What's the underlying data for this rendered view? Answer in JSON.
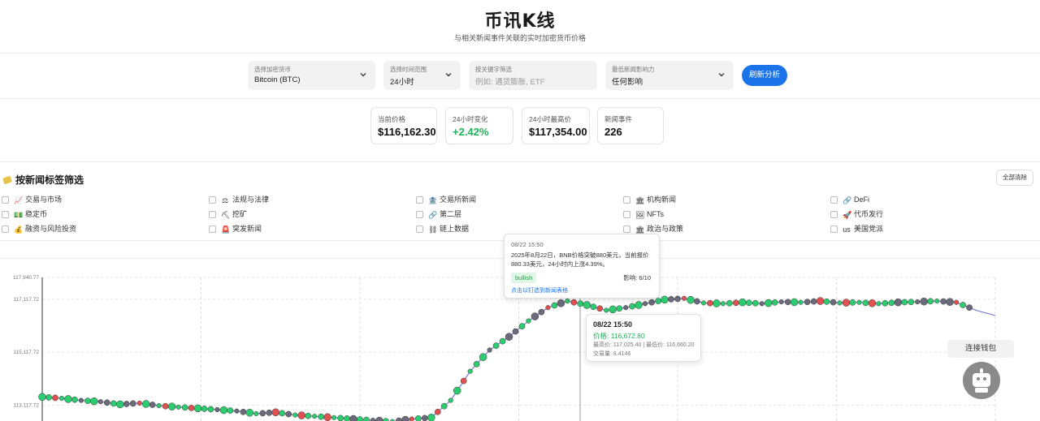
{
  "header": {
    "title": "币讯K线",
    "subtitle": "与相关新闻事件关联的实时加密货币价格"
  },
  "filters": {
    "crypto": {
      "label": "选择加密货币",
      "value": "Bitcoin (BTC)"
    },
    "time_range": {
      "label": "选择时间范围",
      "value": "24小时"
    },
    "keyword": {
      "label": "按关键字筛选",
      "placeholder": "例如: 通货膨胀, ETF"
    },
    "impact": {
      "label": "最低新闻影响力",
      "value": "任何影响"
    },
    "refresh_label": "刷新分析"
  },
  "stats": [
    {
      "label": "当前价格",
      "value": "$116,162.30"
    },
    {
      "label": "24小时变化",
      "value": "+2.42%"
    },
    {
      "label": "24小时最高价",
      "value": "$117,354.00"
    },
    {
      "label": "新闻事件",
      "value": "226"
    }
  ],
  "tags_section": {
    "title": "按新闻标签筛选",
    "clear_all": "全部清除",
    "tags": [
      {
        "label": "交易与市场",
        "icon": "📈"
      },
      {
        "label": "法规与法律",
        "icon": "⚖"
      },
      {
        "label": "交易所新闻",
        "icon": "🏦"
      },
      {
        "label": "机构新闻",
        "icon": "🏛"
      },
      {
        "label": "DeFi",
        "icon": "🔗"
      },
      {
        "label": "稳定币",
        "icon": "💵"
      },
      {
        "label": "挖矿",
        "icon": "⛏"
      },
      {
        "label": "第二层",
        "icon": "🔗"
      },
      {
        "label": "NFTs",
        "icon": "🖼"
      },
      {
        "label": "代币发行",
        "icon": "🚀"
      },
      {
        "label": "融资与风险投资",
        "icon": "💰"
      },
      {
        "label": "突发新闻",
        "icon": "🚨"
      },
      {
        "label": "链上数据",
        "icon": "⛓"
      },
      {
        "label": "政治与政策",
        "icon": "🏛"
      },
      {
        "label": "美国党派",
        "icon": "us"
      }
    ]
  },
  "tooltip_news": {
    "date": "08/22 15:50",
    "text": "2025年8月22日，BNB价格突破880美元，当前报价880.33美元，24小时内上涨4.39%。",
    "sentiment": "bullish",
    "impact": "影响: 6/10",
    "link": "点击以钉选到新闻表格"
  },
  "tooltip_price": {
    "date": "08/22 15:50",
    "price": "价格: 116,672.80",
    "high_low": "最高价: 117,025.40 | 最低价: 116,660.20",
    "volume": "交易量: 8.4146"
  },
  "wallet_label": "连接钱包",
  "colors": {
    "accent": "#1a73e8",
    "positive": "#20b15a",
    "bullish_dot": "#2ecc71",
    "bearish_dot": "#e05252",
    "neutral_dot": "#6b6b7b",
    "line": "#6e6ed6"
  },
  "chart_data": {
    "type": "line",
    "y_ticks": [
      "117,940.77",
      "117,117.72",
      "115,117.72",
      "113,117.72"
    ],
    "series": [
      {
        "values": [
          113430,
          113380,
          113300,
          113250,
          113150,
          113200,
          113100,
          113050,
          113000,
          112950,
          112900,
          112800,
          112850,
          112750,
          112700,
          112650,
          112600,
          112550,
          112500,
          112600,
          112650,
          113300,
          114400,
          115200,
          115700,
          116300,
          116800,
          117050,
          116900,
          116700,
          116800,
          116950,
          117100,
          117150,
          116980,
          116950,
          117000,
          116950,
          117020,
          117000,
          117050,
          116980,
          117000,
          116950,
          117000,
          117020,
          117050,
          117000,
          116700,
          116500
        ]
      }
    ],
    "ylim": [
      112400,
      117940
    ],
    "grid": true
  }
}
